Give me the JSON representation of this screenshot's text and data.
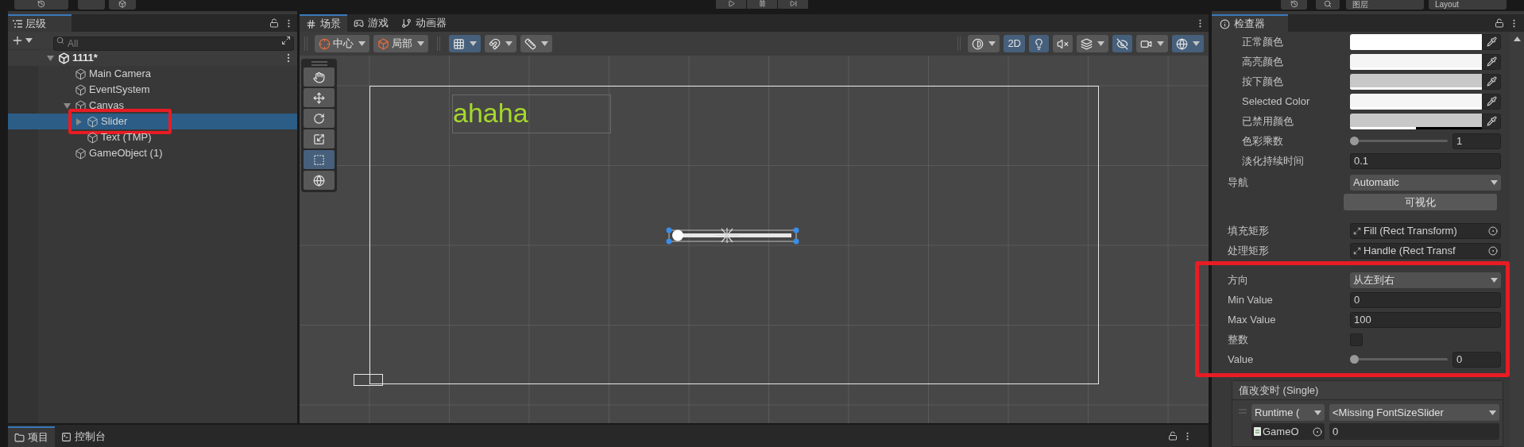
{
  "top_bar": {
    "layers_dropdown": "图层",
    "layout_dropdown": "Layout"
  },
  "hierarchy": {
    "tab": "层级",
    "search": {
      "placeholder": "All"
    },
    "tree": [
      {
        "label": "1111*",
        "kind": "scene",
        "expanded": true,
        "selected": false,
        "highlighted": false,
        "children": [
          {
            "label": "Main Camera",
            "kind": "object",
            "selected": false,
            "highlighted": false
          },
          {
            "label": "EventSystem",
            "kind": "object",
            "selected": false,
            "highlighted": false
          },
          {
            "label": "Canvas",
            "kind": "object",
            "expanded": true,
            "selected": false,
            "highlighted": false,
            "children": [
              {
                "label": "Slider",
                "kind": "object",
                "expanded": false,
                "selected": true,
                "highlighted": true
              },
              {
                "label": "Text (TMP)",
                "kind": "object",
                "selected": false,
                "highlighted": false
              }
            ]
          },
          {
            "label": "GameObject (1)",
            "kind": "object",
            "selected": false,
            "highlighted": false
          }
        ]
      }
    ]
  },
  "scene_tabs": [
    {
      "label": "场景",
      "kind": "scene",
      "selected": true
    },
    {
      "label": "游戏",
      "kind": "game",
      "selected": false
    },
    {
      "label": "动画器",
      "kind": "animator",
      "selected": false
    }
  ],
  "scene_toolbar": {
    "left": [
      {
        "kind": "pivot",
        "label": "中心",
        "on": false
      },
      {
        "kind": "local",
        "label": "局部",
        "on": false
      },
      {
        "kind": "grid",
        "on": true
      },
      {
        "kind": "snap",
        "on": false
      },
      {
        "kind": "ruler",
        "on": false
      }
    ],
    "right": [
      {
        "kind": "shading",
        "on": false
      },
      {
        "kind": "dimension",
        "label": "2D",
        "on": true
      },
      {
        "kind": "light",
        "on": true
      },
      {
        "kind": "audio",
        "on": false
      },
      {
        "kind": "effects",
        "on": false
      },
      {
        "kind": "visibility",
        "on": true
      },
      {
        "kind": "camera",
        "on": false
      },
      {
        "kind": "gizmos",
        "on": true
      }
    ]
  },
  "tools": [
    {
      "kind": "hand",
      "selected": false
    },
    {
      "kind": "move",
      "selected": false
    },
    {
      "kind": "rotate",
      "selected": false
    },
    {
      "kind": "scale",
      "selected": false
    },
    {
      "kind": "rect",
      "selected": true
    },
    {
      "kind": "transform",
      "selected": false
    }
  ],
  "scene_view": {
    "text": "ahaha"
  },
  "inspector": {
    "tab": "检查器",
    "color_tint": [
      {
        "kind": "color",
        "label": "正常颜色",
        "color": "#ffffff",
        "level": 1
      },
      {
        "kind": "color",
        "label": "高亮颜色",
        "color": "#f5f5f5",
        "level": 1
      },
      {
        "kind": "color",
        "label": "按下颜色",
        "color": "#c8c8c8",
        "level": 1
      },
      {
        "kind": "color",
        "label": "Selected Color",
        "color": "#f5f5f5",
        "level": 1
      },
      {
        "kind": "color",
        "label": "已禁用颜色",
        "color": "#c8c8c8",
        "level": 0.5
      },
      {
        "kind": "slider",
        "label": "色彩乘数",
        "level": 0,
        "value": "1"
      },
      {
        "kind": "number",
        "label": "淡化持续时间",
        "value": "0.1"
      }
    ],
    "rows": [
      {
        "kind": "dropdown",
        "label": "导航",
        "value": "Automatic"
      },
      {
        "kind": "button",
        "label": "可视化"
      },
      {
        "kind": "object",
        "label": "填充矩形",
        "value": "Fill (Rect Transform)"
      },
      {
        "kind": "object",
        "label": "处理矩形",
        "value": "Handle (Rect Transf"
      }
    ],
    "slider_section": {
      "highlighted": true,
      "rows": [
        {
          "kind": "dropdown",
          "label": "方向",
          "value": "从左到右"
        },
        {
          "kind": "number",
          "label": "Min Value",
          "value": "0"
        },
        {
          "kind": "number",
          "label": "Max Value",
          "value": "100"
        },
        {
          "kind": "checkbox",
          "label": "整数",
          "checked": false
        },
        {
          "kind": "slider",
          "label": "Value",
          "level": 0,
          "value": "0"
        }
      ]
    },
    "event": {
      "title": "值改变时 (Single)",
      "mode": "Runtime (",
      "method": "<Missing FontSizeSlider",
      "object": "GameO",
      "value": "0"
    }
  },
  "bottom_tabs": [
    {
      "label": "项目",
      "kind": "project",
      "selected": true
    },
    {
      "label": "控制台",
      "kind": "console",
      "selected": false
    }
  ]
}
